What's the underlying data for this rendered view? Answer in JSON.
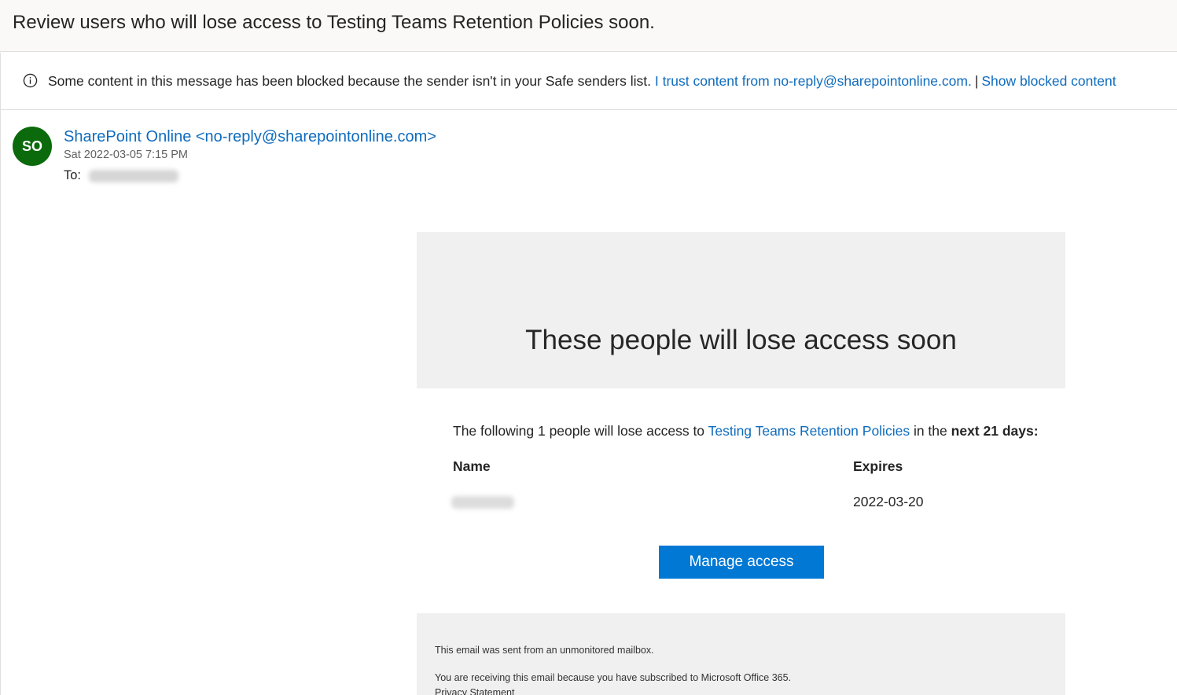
{
  "email": {
    "subject": "Review users who will lose access to Testing Teams Retention Policies soon.",
    "notice": {
      "text": "Some content in this message has been blocked because the sender isn't in your Safe senders list.",
      "trust_link": "I trust content from no-reply@sharepointonline.com.",
      "separator": "|",
      "show_link": "Show blocked content",
      "icon": "info-icon"
    },
    "sender": {
      "initials": "SO",
      "name_email": "SharePoint Online <no-reply@sharepointonline.com>",
      "date": "Sat 2022-03-05 7:15 PM",
      "to_label": "To:",
      "avatar_color": "#0b6a0b"
    }
  },
  "body": {
    "hero_title": "These people will lose access soon",
    "intro": {
      "prefix": "The following 1 people will lose access to",
      "site_link": "Testing Teams Retention Policies",
      "middle": "in the",
      "bold": "next 21 days:"
    },
    "table": {
      "headers": [
        "Name",
        "Expires"
      ],
      "rows": [
        {
          "expires": "2022-03-20"
        }
      ]
    },
    "button_label": "Manage access",
    "footer": [
      "This email was sent from an unmonitored mailbox.",
      "You are receiving this email because you have subscribed to Microsoft Office 365.",
      "Privacy Statement"
    ]
  },
  "colors": {
    "link": "#0f6cbd",
    "button": "#0078d4"
  }
}
